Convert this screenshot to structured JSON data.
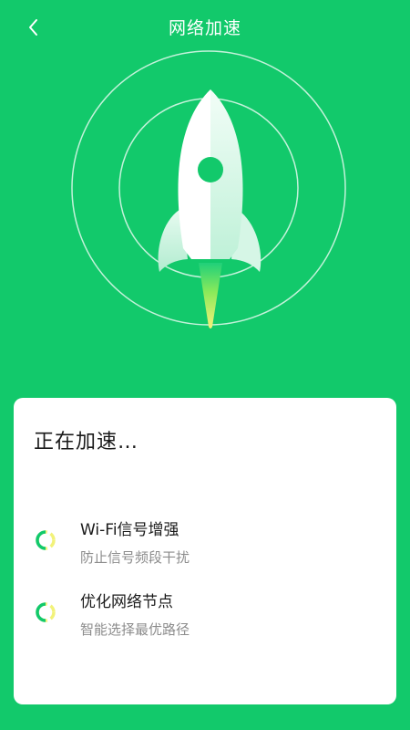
{
  "header": {
    "title": "网络加速",
    "back_icon": "chevron-left-icon"
  },
  "hero": {
    "illustration": "rocket-icon"
  },
  "card": {
    "status": "正在加速…",
    "tasks": [
      {
        "title": "Wi-Fi信号增强",
        "subtitle": "防止信号频段干扰",
        "icon": "loading-spinner-icon"
      },
      {
        "title": "优化网络节点",
        "subtitle": "智能选择最优路径",
        "icon": "loading-spinner-icon"
      }
    ]
  },
  "colors": {
    "background": "#12c96b",
    "card": "#ffffff",
    "spinner_start": "#12c96b",
    "spinner_end": "#f2f27a"
  }
}
